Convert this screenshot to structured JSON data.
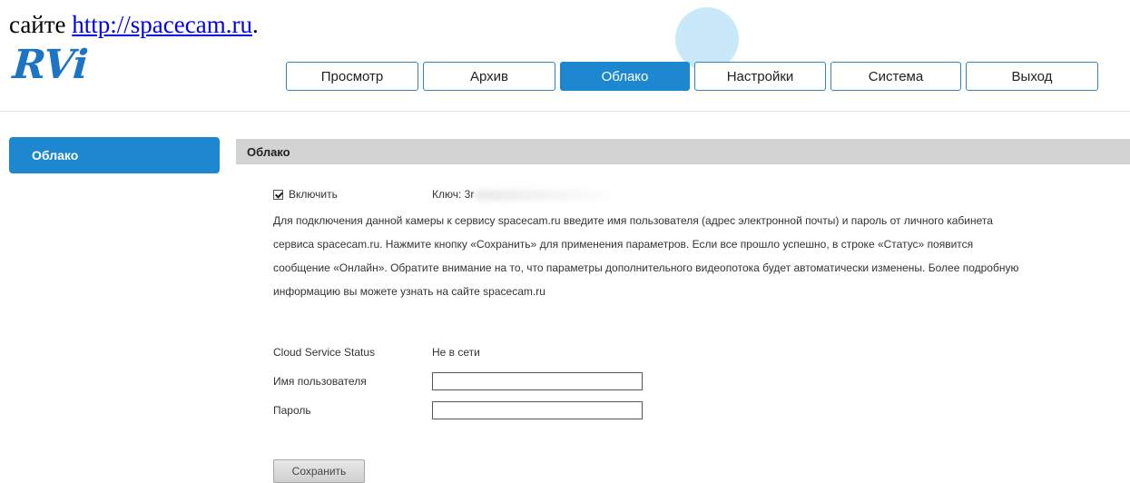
{
  "doc_text": {
    "prefix": "сайте ",
    "link": "http://spacecam.ru",
    "suffix": "."
  },
  "logo": "RVi",
  "nav": {
    "tabs": [
      {
        "label": "Просмотр"
      },
      {
        "label": "Архив"
      },
      {
        "label": "Облако",
        "active": true
      },
      {
        "label": "Настройки"
      },
      {
        "label": "Система"
      },
      {
        "label": "Выход"
      }
    ]
  },
  "sidebar": {
    "items": [
      {
        "label": "Облако",
        "active": true
      }
    ]
  },
  "panel": {
    "title": "Облако",
    "enable_label": "Включить",
    "enable_checked": true,
    "key_label": "Ключ: 3r",
    "description": [
      "Для подключения данной камеры к сервису spacecam.ru введите имя пользователя (адрес электронной почты) и пароль от личного кабинета",
      "сервиса spacecam.ru. Нажмите кнопку «Сохранить» для применения параметров. Если все прошло успешно, в строке «Статус» появится",
      "сообщение «Онлайн». Обратите внимание на то, что параметры дополнительного видеопотока будет автоматически изменены. Более подробную",
      "информацию вы можете узнать на сайте spacecam.ru"
    ],
    "status_label": "Cloud Service Status",
    "status_value": "Не в сети",
    "username_label": "Имя пользователя",
    "username_value": "",
    "password_label": "Пароль",
    "password_value": "",
    "save_label": "Сохранить"
  },
  "colors": {
    "accent": "#1d88d0",
    "header_bg": "#d3d3d3",
    "logo": "#1e74c4"
  }
}
